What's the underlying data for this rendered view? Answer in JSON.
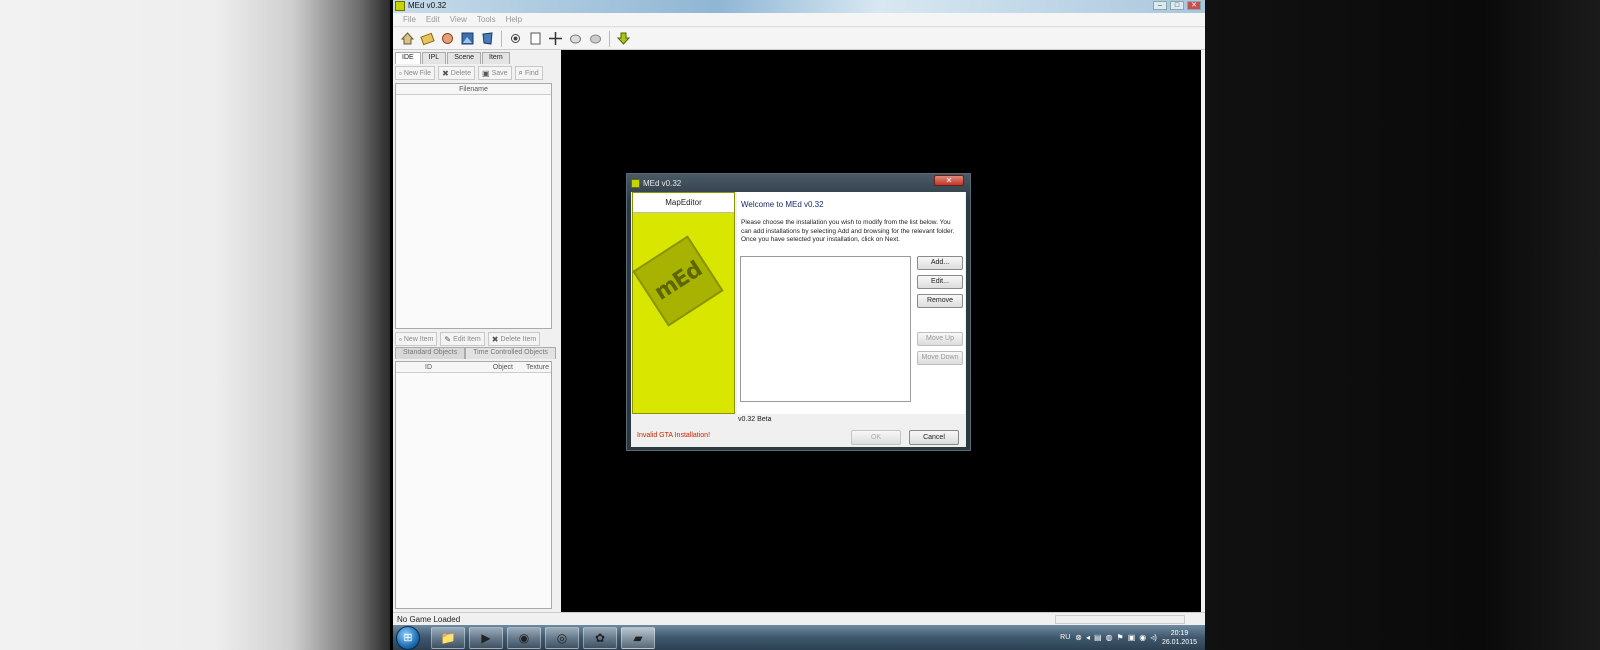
{
  "window": {
    "title": "MEd v0.32",
    "min": "–",
    "max": "□",
    "close": "✕"
  },
  "menu": [
    "File",
    "Edit",
    "View",
    "Tools",
    "Help"
  ],
  "toolbar_icons": [
    "home-icon",
    "open-icon",
    "tool-icon",
    "image-icon",
    "map-icon",
    "record-icon",
    "page-icon",
    "move-icon",
    "hand-icon",
    "hand-open-icon",
    "download-arrow-icon"
  ],
  "left": {
    "tabs": [
      "IDE",
      "IPL",
      "Scene",
      "Item"
    ],
    "file_buttons": {
      "new": "New File",
      "delete": "Delete",
      "save": "Save",
      "find": "Find"
    },
    "file_list_header": "Filename",
    "item_buttons": {
      "new": "New Item",
      "edit": "Edit Item",
      "delete": "Delete Item"
    },
    "object_tabs": [
      "Standard Objects",
      "Time Controlled Objects"
    ],
    "object_columns": [
      "ID",
      "Object",
      "Texture"
    ]
  },
  "status": {
    "text": "No Game Loaded"
  },
  "taskbar": {
    "lang": "RU",
    "time": "20:19",
    "date": "26.01.2015"
  },
  "dialog": {
    "title": "MEd v0.32",
    "brand": "MapEditor",
    "logo_text": "mEd",
    "welcome_title": "Welcome to MEd v0.32",
    "instructions_1": "Please choose the installation you wish to modify from the list below. You can add installations by selecting Add and browsing for the relevant folder.",
    "instructions_2": "Once you have selected your installation, click on Next.",
    "buttons": {
      "add": "Add...",
      "edit": "Edit...",
      "remove": "Remove",
      "move_up": "Move Up",
      "move_down": "Move Down",
      "ok": "OK",
      "cancel": "Cancel"
    },
    "version": "v0.32 Beta",
    "error": "Invalid GTA Installation!"
  },
  "colors": {
    "brand_yellow": "#d9e600",
    "error_red": "#cc2200"
  }
}
